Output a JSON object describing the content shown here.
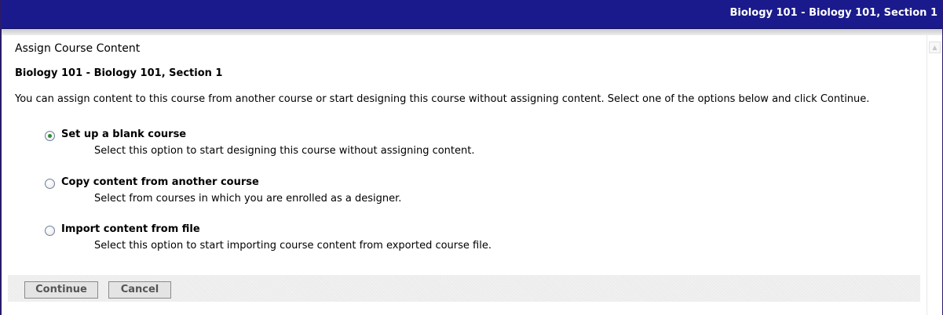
{
  "header": {
    "title": "Biology 101 - Biology 101, Section 1"
  },
  "page": {
    "heading": "Assign Course Content",
    "course_title": "Biology 101 - Biology 101, Section 1",
    "instructions": "You can assign content to this course from another course or start designing this course without assigning content. Select one of the options below and click Continue."
  },
  "options": [
    {
      "label": "Set up a blank course",
      "description": "Select this option to start designing this course without assigning content.",
      "selected": true
    },
    {
      "label": "Copy content from another course",
      "description": "Select from courses in which you are enrolled as a designer.",
      "selected": false
    },
    {
      "label": "Import content from file",
      "description": "Select this option to start importing course content from exported course file.",
      "selected": false
    }
  ],
  "buttons": {
    "continue": "Continue",
    "cancel": "Cancel"
  },
  "colors": {
    "title_bar": "#1a1a8c",
    "selected_radio": "#2e8b3a"
  }
}
